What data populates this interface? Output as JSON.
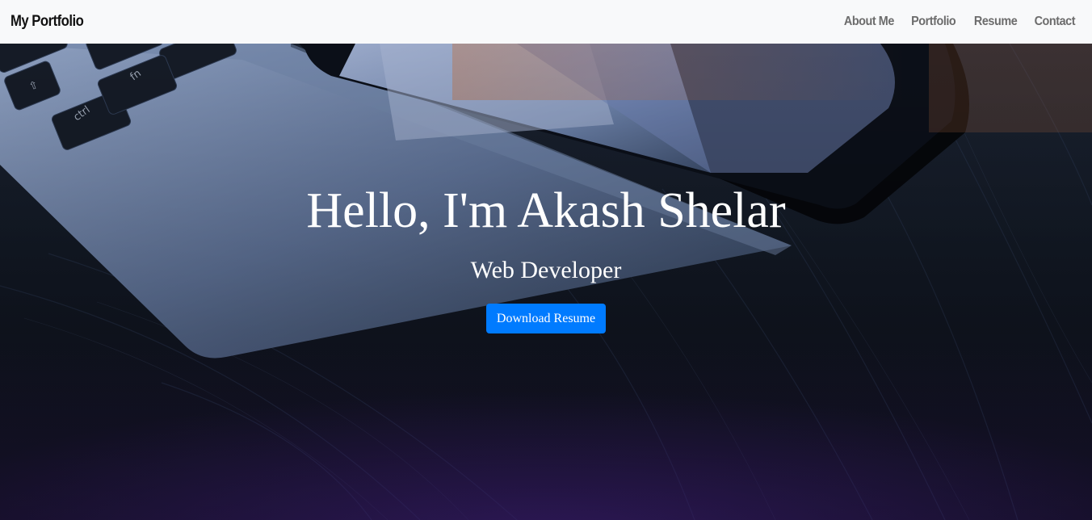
{
  "navbar": {
    "brand": "My Portfolio",
    "links": [
      {
        "label": "About Me"
      },
      {
        "label": "Portfolio"
      },
      {
        "label": "Resume"
      },
      {
        "label": "Contact"
      }
    ]
  },
  "hero": {
    "title": "Hello, I'm Akash Shelar",
    "subtitle": "Web Developer",
    "button_label": "Download Resume",
    "background_image": "laptop-keyboard-and-tablet-on-dark-wooden-desk"
  },
  "colors": {
    "navbar_bg": "#f8f9fa",
    "brand": "#111111",
    "nav_link": "#6c6c6c",
    "button_bg": "#007bff",
    "hero_text": "#ffffff"
  }
}
